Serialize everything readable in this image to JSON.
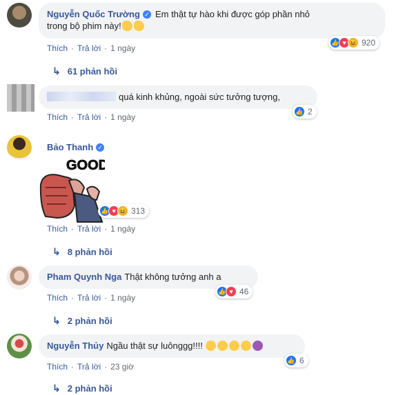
{
  "comments": [
    {
      "author": "Nguyễn Quốc Trường",
      "text_line1": "Em thật tự hào khi được góp phần nhỏ",
      "text_line2": "trong bộ phim này!",
      "like": "Thích",
      "reply": "Trả lời",
      "time": "1 ngày",
      "reactions": "920",
      "replies": "61 phản hồi"
    },
    {
      "text": "quá kinh khủng, ngoài sức tưởng tượng,",
      "like": "Thích",
      "reply": "Trả lời",
      "time": "1 ngày",
      "reactions": "2"
    },
    {
      "author": "Bảo Thanh",
      "sticker_text": "GOOD",
      "like": "Thích",
      "reply": "Trả lời",
      "time": "1 ngày",
      "reactions": "313",
      "replies": "8 phản hồi"
    },
    {
      "author": "Pham Quynh Nga",
      "text": "Thật không tưởng anh a",
      "like": "Thích",
      "reply": "Trả lời",
      "time": "1 ngày",
      "reactions": "46",
      "replies": "2 phản hồi"
    },
    {
      "author": "Nguyễn Thủy",
      "text": "Ngầu thật sự luônggg!!!!",
      "like": "Thích",
      "reply": "Trả lời",
      "time": "23 giờ",
      "reactions": "6",
      "replies": "2 phản hồi"
    }
  ],
  "colors": {
    "link": "#385898",
    "bubble": "#f2f3f5",
    "like": "#1877f2",
    "love": "#f33e58"
  }
}
